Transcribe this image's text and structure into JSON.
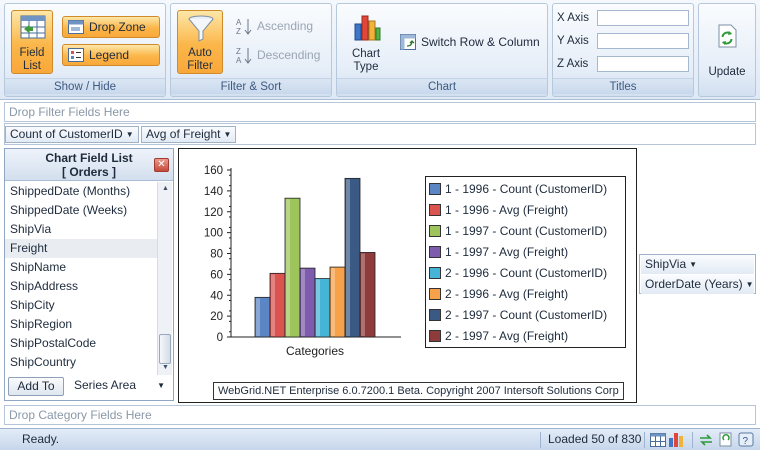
{
  "ribbon": {
    "show_hide": {
      "label": "Show / Hide",
      "field_list": "Field List",
      "drop_zone": "Drop Zone",
      "legend": "Legend"
    },
    "filter_sort": {
      "label": "Filter & Sort",
      "auto_filter": "Auto Filter",
      "ascending": "Ascending",
      "descending": "Descending"
    },
    "chart": {
      "label": "Chart",
      "chart_type": "Chart Type",
      "switch_row_column": "Switch Row & Column"
    },
    "titles": {
      "label": "Titles",
      "x_axis": "X Axis",
      "y_axis": "Y Axis",
      "z_axis": "Z Axis",
      "x_value": "",
      "y_value": "",
      "z_value": ""
    },
    "update": "Update"
  },
  "zones": {
    "filter_placeholder": "Drop Filter Fields Here",
    "category_placeholder": "Drop Category Fields Here",
    "data_fields": [
      "Count of CustomerID",
      "Avg of Freight"
    ],
    "series_fields": [
      "ShipVia",
      "OrderDate (Years)"
    ]
  },
  "field_list": {
    "title": "Chart Field List",
    "subtitle": "[ Orders ]",
    "items": [
      "ShippedDate (Months)",
      "ShippedDate (Weeks)",
      "ShipVia",
      "Freight",
      "ShipName",
      "ShipAddress",
      "ShipCity",
      "ShipRegion",
      "ShipPostalCode",
      "ShipCountry"
    ],
    "selected": "Freight",
    "add_to": "Add To",
    "area": "Series Area"
  },
  "chart_data": {
    "type": "bar",
    "categories": [
      "Categories"
    ],
    "series": [
      {
        "name": "1 - 1996 - Count (CustomerID)",
        "values": [
          38
        ],
        "color": "#5b86c5"
      },
      {
        "name": "1 - 1996 - Avg (Freight)",
        "values": [
          61
        ],
        "color": "#d9534f"
      },
      {
        "name": "1 - 1997 - Count (CustomerID)",
        "values": [
          133
        ],
        "color": "#9dc55b"
      },
      {
        "name": "1 - 1997 - Avg (Freight)",
        "values": [
          66
        ],
        "color": "#7d5cae"
      },
      {
        "name": "2 - 1996 - Count (CustomerID)",
        "values": [
          56
        ],
        "color": "#45b4d6"
      },
      {
        "name": "2 - 1996 - Avg (Freight)",
        "values": [
          67
        ],
        "color": "#f7a14a"
      },
      {
        "name": "2 - 1997 - Count (CustomerID)",
        "values": [
          152
        ],
        "color": "#3a5a85"
      },
      {
        "name": "2 - 1997 - Avg (Freight)",
        "values": [
          81
        ],
        "color": "#8e3b3b"
      }
    ],
    "yticks": [
      "0",
      "20",
      "40",
      "60",
      "80",
      "100",
      "120",
      "140",
      "160"
    ],
    "ylim": [
      0,
      160
    ],
    "grid": false,
    "legend": "right"
  },
  "copyright": "WebGrid.NET Enterprise 6.0.7200.1 Beta. Copyright 2007 Intersoft Solutions Corp",
  "status": {
    "text": "Ready.",
    "loaded": "Loaded 50 of 830"
  }
}
